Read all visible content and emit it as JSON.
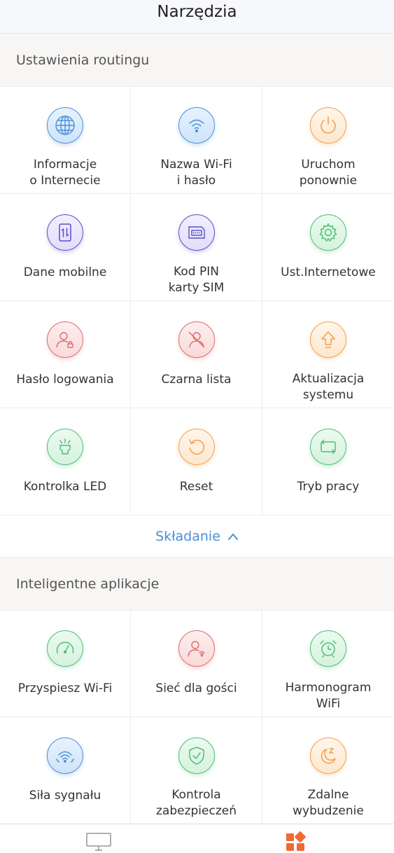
{
  "header": {
    "title": "Narzędzia"
  },
  "routing": {
    "title": "Ustawienia routingu",
    "items": [
      {
        "label": "Informacje\no Internecie",
        "color": "#4a90d9",
        "icon": "globe-icon"
      },
      {
        "label": "Nazwa Wi-Fi\ni hasło",
        "color": "#4a90d9",
        "icon": "wifi-icon"
      },
      {
        "label": "Uruchom\nponownie",
        "color": "#f2a14a",
        "icon": "power-icon"
      },
      {
        "label": "Dane mobilne",
        "color": "#5a4fc7",
        "icon": "mobile-data-icon"
      },
      {
        "label": "Kod PIN\nkarty SIM",
        "color": "#5a4fc7",
        "icon": "sim-card-icon"
      },
      {
        "label": "Ust.Internetowe",
        "color": "#4cbf74",
        "icon": "gear-icon"
      },
      {
        "label": "Hasło logowania",
        "color": "#e06a6a",
        "icon": "user-lock-icon"
      },
      {
        "label": "Czarna lista",
        "color": "#e06a6a",
        "icon": "user-blocked-icon"
      },
      {
        "label": "Aktualizacja\nsystemu",
        "color": "#f2a14a",
        "icon": "upgrade-arrow-icon"
      },
      {
        "label": "Kontrolka LED",
        "color": "#4cbf74",
        "icon": "led-light-icon"
      },
      {
        "label": "Reset",
        "color": "#f2a14a",
        "icon": "reset-icon"
      },
      {
        "label": "Tryb pracy",
        "color": "#4cbf74",
        "icon": "work-mode-icon"
      }
    ]
  },
  "fold": {
    "label": "Składanie"
  },
  "apps": {
    "title": "Inteligentne aplikacje",
    "items": [
      {
        "label": "Przyspiesz Wi-Fi",
        "color": "#4cbf74",
        "icon": "speedometer-icon"
      },
      {
        "label": "Sieć dla gości",
        "color": "#e06a6a",
        "icon": "guest-user-icon"
      },
      {
        "label": "Harmonogram\nWiFi",
        "color": "#4cbf74",
        "icon": "alarm-clock-icon"
      },
      {
        "label": "Siła sygnału",
        "color": "#4a90d9",
        "icon": "signal-strength-icon"
      },
      {
        "label": "Kontrola\nzabezpieczeń",
        "color": "#4cbf74",
        "icon": "shield-check-icon"
      },
      {
        "label": "Zdalne\nwybudzenie",
        "color": "#f2a14a",
        "icon": "moon-sleep-icon"
      }
    ]
  },
  "bottom_nav": [
    {
      "name": "device",
      "icon": "monitor-icon",
      "active": false,
      "color": "#999999"
    },
    {
      "name": "tools",
      "icon": "apps-grid-icon",
      "active": true,
      "color": "#f06a33"
    }
  ]
}
